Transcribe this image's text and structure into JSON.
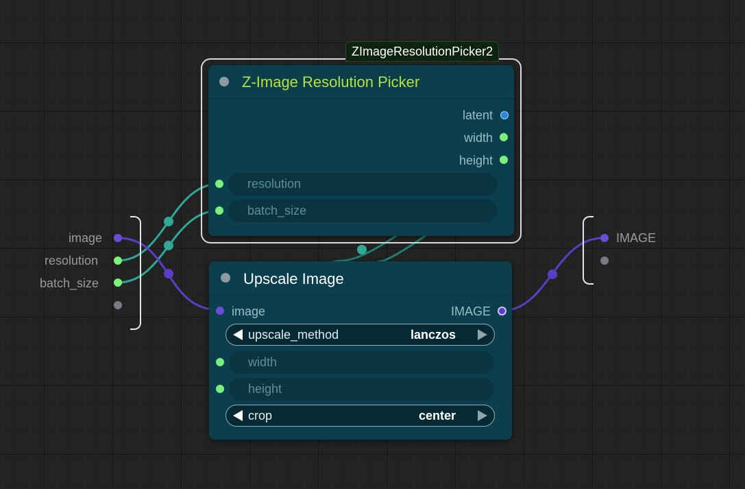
{
  "canvas": {
    "group_tag": "ZImageResolutionPicker2",
    "colors": {
      "background": "#222222",
      "node_body": "#0b3f4d",
      "title_picker": "#b6e23a",
      "link_teal": "#2fa896",
      "link_purple": "#5a3ec8",
      "slot_green": "#7cf07c"
    }
  },
  "left_io": {
    "items": [
      {
        "label": "image",
        "icon": "purple-port-dot"
      },
      {
        "label": "resolution",
        "icon": "green-port-dot"
      },
      {
        "label": "batch_size",
        "icon": "green-port-dot"
      },
      {
        "label": "",
        "icon": "grey-port-dot"
      }
    ]
  },
  "right_io": {
    "items": [
      {
        "label": "IMAGE",
        "icon": "purple-port-dot"
      },
      {
        "label": "",
        "icon": "grey-port-dot"
      }
    ]
  },
  "picker_node": {
    "title": "Z-Image Resolution Picker",
    "outputs": [
      "latent",
      "width",
      "height"
    ],
    "widgets": [
      "resolution",
      "batch_size"
    ]
  },
  "upscale_node": {
    "title": "Upscale Image",
    "input": "image",
    "output": "IMAGE",
    "upscale_method": {
      "name": "upscale_method",
      "value": "lanczos"
    },
    "widgets": [
      "width",
      "height"
    ],
    "crop": {
      "name": "crop",
      "value": "center"
    }
  }
}
